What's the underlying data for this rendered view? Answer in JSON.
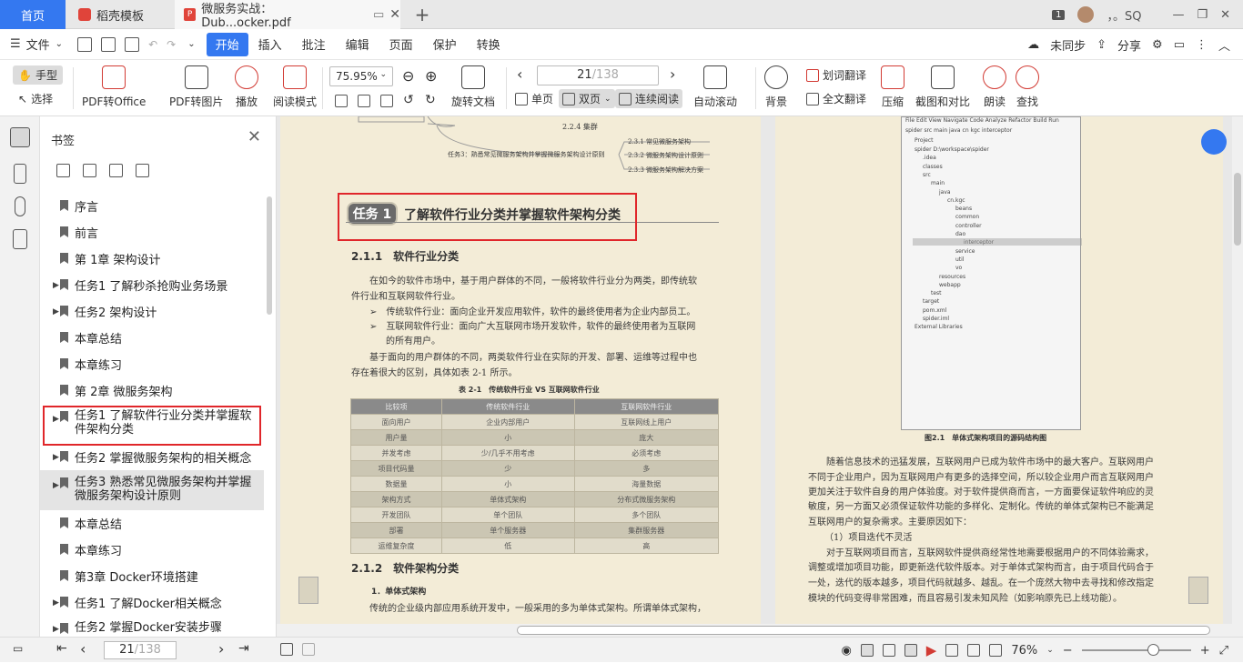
{
  "tabs": {
    "home": "首页",
    "templates": "稻壳模板",
    "document": "微服务实战：Dub...ocker.pdf",
    "badge": "1",
    "user": "，。SQ"
  },
  "menu": {
    "file": "文件",
    "start": "开始",
    "insert": "插入",
    "annotate": "批注",
    "edit": "编辑",
    "page": "页面",
    "protect": "保护",
    "convert": "转换",
    "unsync": "未同步",
    "share": "分享"
  },
  "ribbon": {
    "hand": "手型",
    "select": "选择",
    "pdf_office": "PDF转Office",
    "pdf_image": "PDF转图片",
    "play": "播放",
    "read_mode": "阅读模式",
    "zoom": "75.95%",
    "rotate": "旋转文档",
    "page_current": "21",
    "page_total": "/138",
    "single": "单页",
    "double": "双页",
    "continuous": "连续阅读",
    "auto_scroll": "自动滚动",
    "background": "背景",
    "word_translate": "划词翻译",
    "full_translate": "全文翻译",
    "compress": "压缩",
    "screenshot": "截图和对比",
    "read_aloud": "朗读",
    "find": "查找"
  },
  "sidebar": {
    "title": "书签",
    "items": [
      "序言",
      "前言",
      "第 1章 架构设计",
      "任务1 了解秒杀抢购业务场景",
      "任务2 架构设计",
      "本章总结",
      "本章练习",
      "第 2章 微服务架构",
      "任务1 了解软件行业分类并掌握软件架构分类",
      "任务2 掌握微服务架构的相关概念",
      "任务3 熟悉常见微服务架构并掌握微服务架构设计原则",
      "本章总结",
      "本章练习",
      "第3章 Docker环境搭建",
      "任务1 了解Docker相关概念",
      "任务2 掌握Docker安装步骤"
    ]
  },
  "left_page": {
    "mind_items": [
      "2.2.4 集群",
      "任务3：熟悉常见微服务架构并掌握微服务架构设计原则",
      "2.3.1 常见微服务架构",
      "2.3.2 微服务架构设计原则",
      "2.3.3 微服务架构解决方案"
    ],
    "task_badge": "任务 1",
    "task_title": "了解软件行业分类并掌握软件架构分类",
    "s211": "2.1.1　软件行业分类",
    "p1a": "在如今的软件市场中，基于用户群体的不同，一般将软件行业分为两类，即传统软",
    "p1b": "件行业和互联网软件行业。",
    "b1": "➢　传统软件行业：面向企业开发应用软件，软件的最终使用者为企业内部员工。",
    "b2a": "➢　互联网软件行业：面向广大互联网市场开发软件，软件的最终使用者为互联网",
    "b2b": "的所有用户。",
    "p2a": "基于面向的用户群体的不同，两类软件行业在实际的开发、部署、运维等过程中也",
    "p2b": "存在着很大的区别，具体如表 2-1 所示。",
    "table_caption": "表 2-1　传统软件行业 VS 互联网软件行业",
    "table_head": [
      "比较项",
      "传统软件行业",
      "互联网软件行业"
    ],
    "table_rows": [
      [
        "面向用户",
        "企业内部用户",
        "互联网线上用户"
      ],
      [
        "用户量",
        "小",
        "庞大"
      ],
      [
        "并发考虑",
        "少/几乎不用考虑",
        "必须考虑"
      ],
      [
        "项目代码量",
        "少",
        "多"
      ],
      [
        "数据量",
        "小",
        "海量数据"
      ],
      [
        "架构方式",
        "单体式架构",
        "分布式微服务架构"
      ],
      [
        "开发团队",
        "单个团队",
        "多个团队"
      ],
      [
        "部署",
        "单个服务器",
        "集群服务器"
      ],
      [
        "运维复杂度",
        "低",
        "高"
      ]
    ],
    "s212": "2.1.2　软件架构分类",
    "s1": "1．单体式架构",
    "p3": "传统的企业级内部应用系统开发中，一般采用的多为单体式架构。所谓单体式架构，"
  },
  "right_page": {
    "ide_menu": "File  Edit  View  Navigate  Code  Analyze  Refactor  Build  Run",
    "ide_crumbs": "spider  src  main  java  cn  kgc  interceptor",
    "ide_project": "Project",
    "ide_tree": [
      "spider  D:\\workspace\\spider",
      ".idea",
      "classes",
      "src",
      "main",
      "java",
      "cn.kgc",
      "beans",
      "common",
      "controller",
      "dao",
      "interceptor",
      "service",
      "util",
      "vo",
      "resources",
      "webapp",
      "test",
      "target",
      "pom.xml",
      "spider.iml",
      "External Libraries"
    ],
    "fig_caption": "图2.1　单体式架构项目的源码结构图",
    "lines": [
      "随着信息技术的迅猛发展，互联网用户已成为软件市场中的最大客户。互联网用户",
      "不同于企业用户，因为互联网用户有更多的选择空间，所以较企业用户而言互联网用户",
      "更加关注于软件自身的用户体验度。对于软件提供商而言，一方面要保证软件响应的灵",
      "敏度，另一方面又必须保证软件功能的多样化、定制化。传统的单体式架构已不能满足",
      "互联网用户的复杂需求。主要原因如下：",
      "（1）项目迭代不灵活",
      "对于互联网项目而言，互联网软件提供商经常性地需要根据用户的不同体验需求，",
      "调整或增加项目功能，即更新迭代软件版本。对于单体式架构而言，由于项目代码合于",
      "一处，迭代的版本越多，项目代码就越多、越乱。在一个庞然大物中去寻找和修改指定",
      "模块的代码变得非常困难，而且容易引发未知风险（如影响原先已上线功能）。"
    ]
  },
  "status": {
    "page_current": "21",
    "page_total": "/138",
    "zoom": "76%"
  }
}
